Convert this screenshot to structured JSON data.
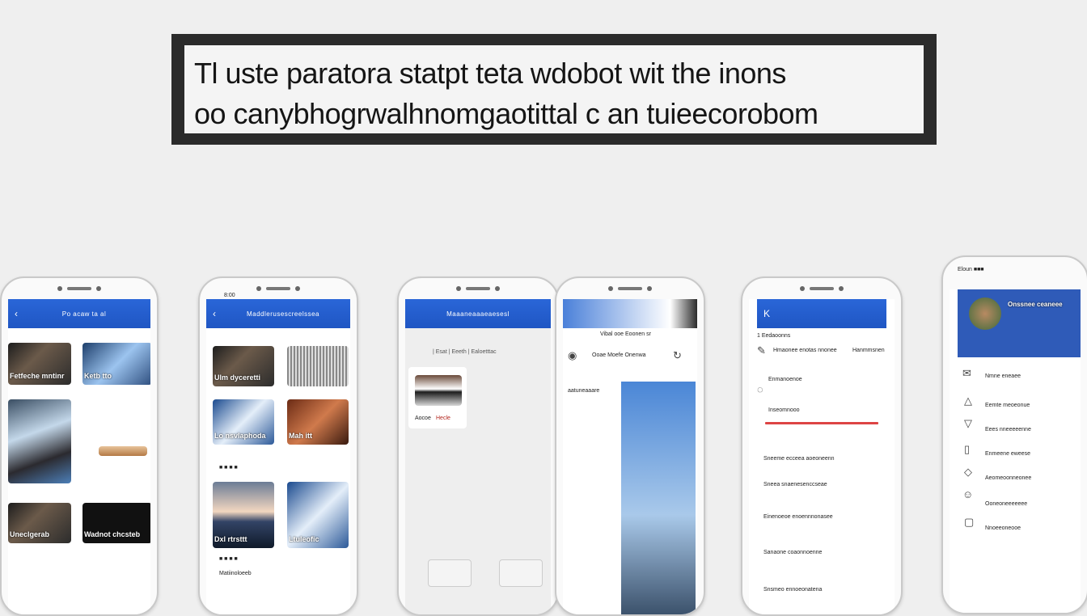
{
  "banner": {
    "line1": "Tl uste paratora statpt teta wdobot wit the inons",
    "line2": "oo canybhogrwalhnomgaotittal c an tuieecorobom"
  },
  "phone1": {
    "title": "Po acaw ta al",
    "card1": "Fetfeche mntinr",
    "card2": "Ketb tto",
    "card3": "Uneclgerab",
    "card4": "Wadnot chcsteb"
  },
  "phone2": {
    "title": "Maddlerusescreelssea",
    "status": "8:00",
    "card1": "Ulm dyceretti",
    "card2": "Lo nsvlaphoda",
    "card3": "Mah itt",
    "card4": "Dxl rtrsttt",
    "card5": "Ltuleofic",
    "card6": "Matiinoloeeb",
    "row1": "■ ■ ■ ■",
    "row2": "■ ■ ■ ■"
  },
  "phone3": {
    "title": "Maaaneaaaeaesesl",
    "tabs": "| Esat | Eeeth | Ealoetttac",
    "card_label": "Aocoe",
    "card_value": "Hecle"
  },
  "phone4": {
    "header": "Vibal ooe Eoonen sr",
    "row1": "Ooae  Moefe Onenwa",
    "row2": "aatuneaaare"
  },
  "phone5": {
    "back": "K",
    "row1": "1 Eedaoonns",
    "row2": "Hmaonee enotas nnonee",
    "row3": "Hanmmsnen",
    "row4": "Enmanoenoe",
    "section": "Inseomnooo",
    "block1": "Sneeme ecceea aoeoneenn",
    "block2": "Sneea  snaenesenccseae",
    "block3": "Einenoeoe enoennnonasee",
    "block4": "Sanaone coaonnoenne",
    "block5": "Snsmeo ennoeonatena"
  },
  "phone6": {
    "status": "Eloun ■■■",
    "header": "Onssnee ceaneee",
    "items": [
      "Nmne eneaee",
      "Eemte meoeonue",
      "Eees nneeeeenne",
      "Enmeene eweese",
      "Aeomeoonneonee",
      "Ooneoneeeeeee",
      "Nnoeeoneooe"
    ]
  }
}
